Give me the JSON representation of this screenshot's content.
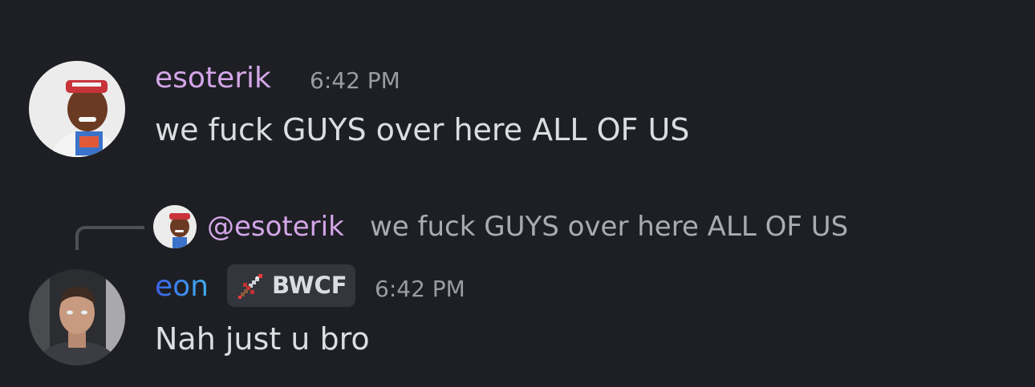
{
  "colors": {
    "background": "#1e1f24",
    "esoterik_name": "#d3a6e8",
    "eon_name_start": "#3a62ea",
    "eon_name_end": "#3fb0f0",
    "message_text": "#dbdee1",
    "muted_text": "#9a9ca5",
    "tag_background": "#34363d"
  },
  "messages": [
    {
      "author": "esoterik",
      "timestamp": "6:42 PM",
      "text": "we fuck GUYS over here ALL OF US",
      "avatar_icon": "user-avatar-photo"
    },
    {
      "reply_to": {
        "mention": "@esoterik",
        "text": "we fuck GUYS over here ALL OF US",
        "avatar_icon": "user-avatar-photo"
      },
      "author": "eon",
      "tag": {
        "label": "BWCF",
        "icon": "sword-icon"
      },
      "timestamp": "6:42 PM",
      "text": "Nah just u bro",
      "avatar_icon": "user-avatar-photo"
    }
  ]
}
